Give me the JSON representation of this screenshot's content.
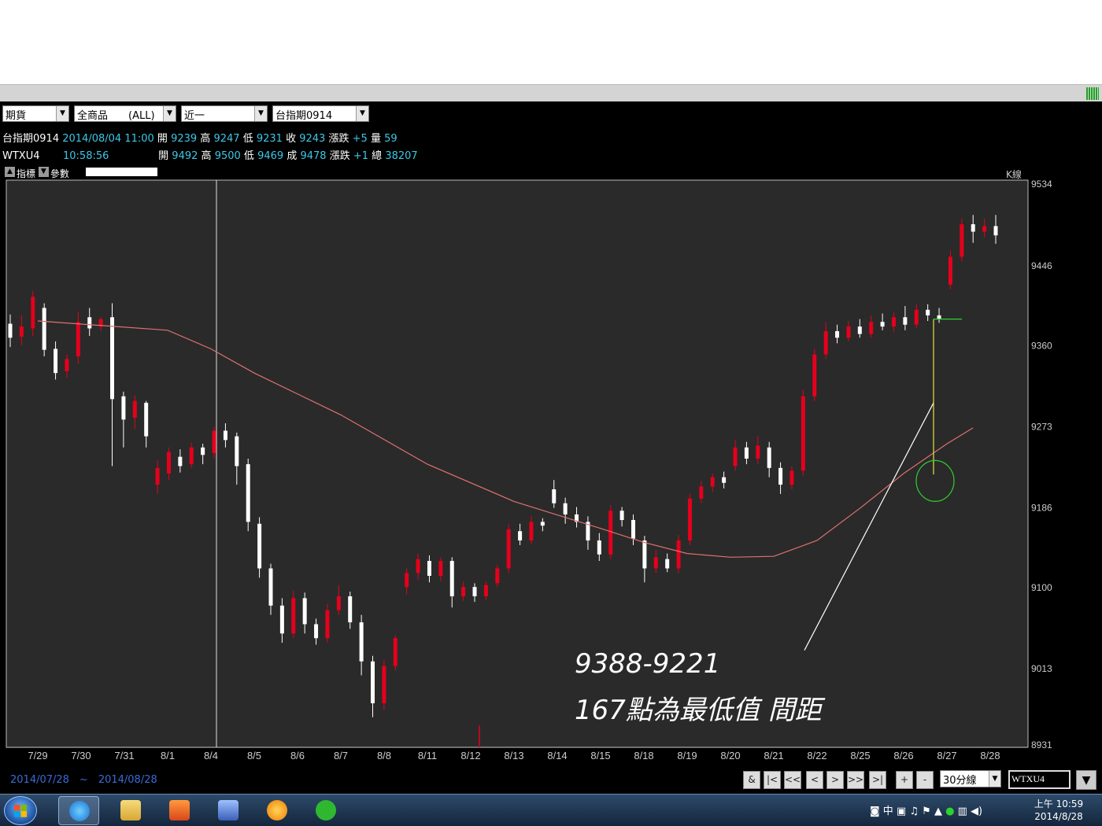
{
  "toolbar": {
    "market": "期貨",
    "product": "全商品　　(ALL)",
    "period": "近一",
    "contract": "台指期0914"
  },
  "quote1": {
    "name": "台指期0914",
    "datetime": "2014/08/04 11:00",
    "open_label": "開",
    "open": "9239",
    "high_label": "高",
    "high": "9247",
    "low_label": "低",
    "low": "9231",
    "close_label": "收",
    "close": "9243",
    "change_label": "漲跌",
    "change": "+5",
    "volume_label": "量",
    "volume": "59"
  },
  "quote2": {
    "name": "WTXU4",
    "time": "10:58:56",
    "open_label": "開",
    "open": "9492",
    "high_label": "高",
    "high": "9500",
    "low_label": "低",
    "low": "9469",
    "close_label": "成",
    "close": "9478",
    "change_label": "漲跌",
    "change": "+1",
    "volume_label": "總",
    "volume": "38207"
  },
  "indicator_bar": {
    "indicator_label": "指標",
    "param_label": "參數",
    "chart_type": "K線"
  },
  "chart_data": {
    "type": "candlestick",
    "y_ticks": [
      "9534",
      "9446",
      "9360",
      "9273",
      "9186",
      "9100",
      "9013",
      "8931"
    ],
    "ylim": [
      8931,
      9534
    ],
    "x_ticks": [
      "7/29",
      "7/30",
      "7/31",
      "8/1",
      "8/4",
      "8/5",
      "8/6",
      "8/7",
      "8/8",
      "8/11",
      "8/12",
      "8/13",
      "8/14",
      "8/15",
      "8/18",
      "8/19",
      "8/20",
      "8/21",
      "8/22",
      "8/25",
      "8/26",
      "8/27",
      "8/28"
    ],
    "interval": "30分線",
    "moving_average": [
      {
        "x": 0,
        "y": 9386
      },
      {
        "x": 3,
        "y": 9376
      },
      {
        "x": 4,
        "y": 9356
      },
      {
        "x": 5,
        "y": 9330
      },
      {
        "x": 7,
        "y": 9285
      },
      {
        "x": 9,
        "y": 9232
      },
      {
        "x": 11,
        "y": 9192
      },
      {
        "x": 13,
        "y": 9163
      },
      {
        "x": 14,
        "y": 9148
      },
      {
        "x": 15,
        "y": 9136
      },
      {
        "x": 16,
        "y": 9132
      },
      {
        "x": 17,
        "y": 9133
      },
      {
        "x": 18,
        "y": 9150
      },
      {
        "x": 19,
        "y": 9185
      },
      {
        "x": 20,
        "y": 9222
      },
      {
        "x": 21,
        "y": 9254
      },
      {
        "x": 21.6,
        "y": 9271
      }
    ],
    "candles": [
      [
        9383,
        9368,
        9393,
        9358
      ],
      [
        9369,
        9380,
        9392,
        9360
      ],
      [
        9378,
        9412,
        9418,
        9370
      ],
      [
        9400,
        9355,
        9405,
        9348
      ],
      [
        9356,
        9330,
        9364,
        9323
      ],
      [
        9332,
        9345,
        9350,
        9325
      ],
      [
        9348,
        9385,
        9396,
        9340
      ],
      [
        9390,
        9378,
        9400,
        9370
      ],
      [
        9380,
        9388,
        9390,
        9375
      ],
      [
        9390,
        9302,
        9405,
        9230
      ],
      [
        9305,
        9280,
        9310,
        9250
      ],
      [
        9282,
        9300,
        9306,
        9270
      ],
      [
        9298,
        9262,
        9300,
        9250
      ],
      [
        9210,
        9228,
        9236,
        9200
      ],
      [
        9222,
        9245,
        9250,
        9215
      ],
      [
        9240,
        9230,
        9248,
        9223
      ],
      [
        9232,
        9250,
        9255,
        9228
      ],
      [
        9250,
        9242,
        9254,
        9232
      ],
      [
        9244,
        9268,
        9272,
        9238
      ],
      [
        9268,
        9258,
        9276,
        9250
      ],
      [
        9262,
        9230,
        9266,
        9210
      ],
      [
        9232,
        9170,
        9238,
        9160
      ],
      [
        9168,
        9120,
        9175,
        9110
      ],
      [
        9120,
        9080,
        9125,
        9070
      ],
      [
        9080,
        9050,
        9088,
        9040
      ],
      [
        9050,
        9088,
        9096,
        9045
      ],
      [
        9088,
        9060,
        9094,
        9050
      ],
      [
        9060,
        9045,
        9066,
        9038
      ],
      [
        9045,
        9075,
        9082,
        9040
      ],
      [
        9075,
        9090,
        9102,
        9070
      ],
      [
        9090,
        9062,
        9095,
        9055
      ],
      [
        9062,
        9020,
        9070,
        9005
      ],
      [
        9020,
        8975,
        9026,
        8960
      ],
      [
        8975,
        9015,
        9022,
        8968
      ],
      [
        9015,
        9045,
        9048,
        9010
      ],
      [
        9100,
        9115,
        9120,
        9092
      ],
      [
        9115,
        9130,
        9136,
        9108
      ],
      [
        9128,
        9112,
        9134,
        9105
      ],
      [
        9112,
        9128,
        9132,
        9106
      ],
      [
        9128,
        9090,
        9132,
        9078
      ],
      [
        9090,
        9100,
        9106,
        9085
      ],
      [
        9100,
        9090,
        9104,
        9084
      ],
      [
        9090,
        9102,
        9106,
        9086
      ],
      [
        9104,
        9120,
        9124,
        9100
      ],
      [
        9120,
        9162,
        9168,
        9115
      ],
      [
        9160,
        9150,
        9168,
        9145
      ],
      [
        9150,
        9170,
        9176,
        9146
      ],
      [
        9170,
        9166,
        9174,
        9160
      ],
      [
        9205,
        9190,
        9215,
        9185
      ],
      [
        9190,
        9178,
        9196,
        9168
      ],
      [
        9178,
        9170,
        9186,
        9164
      ],
      [
        9170,
        9150,
        9176,
        9140
      ],
      [
        9150,
        9135,
        9158,
        9128
      ],
      [
        9135,
        9182,
        9188,
        9130
      ],
      [
        9182,
        9172,
        9186,
        9165
      ],
      [
        9172,
        9152,
        9178,
        9145
      ],
      [
        9150,
        9120,
        9155,
        9105
      ],
      [
        9120,
        9132,
        9140,
        9115
      ],
      [
        9130,
        9120,
        9136,
        9116
      ],
      [
        9120,
        9150,
        9156,
        9115
      ],
      [
        9150,
        9195,
        9200,
        9145
      ],
      [
        9195,
        9208,
        9214,
        9190
      ],
      [
        9208,
        9218,
        9222,
        9202
      ],
      [
        9218,
        9212,
        9224,
        9206
      ],
      [
        9230,
        9250,
        9258,
        9225
      ],
      [
        9250,
        9238,
        9256,
        9232
      ],
      [
        9238,
        9252,
        9262,
        9232
      ],
      [
        9250,
        9228,
        9256,
        9218
      ],
      [
        9228,
        9210,
        9234,
        9200
      ],
      [
        9210,
        9225,
        9230,
        9205
      ],
      [
        9225,
        9305,
        9312,
        9220
      ],
      [
        9305,
        9350,
        9356,
        9300
      ],
      [
        9350,
        9375,
        9385,
        9345
      ],
      [
        9375,
        9368,
        9382,
        9362
      ],
      [
        9368,
        9380,
        9386,
        9364
      ],
      [
        9380,
        9372,
        9388,
        9368
      ],
      [
        9372,
        9385,
        9392,
        9368
      ],
      [
        9385,
        9380,
        9394,
        9376
      ],
      [
        9380,
        9390,
        9396,
        9374
      ],
      [
        9390,
        9382,
        9402,
        9376
      ],
      [
        9382,
        9398,
        9404,
        9378
      ],
      [
        9398,
        9392,
        9404,
        9386
      ],
      [
        9392,
        9388,
        9400,
        9384
      ],
      [
        9425,
        9455,
        9462,
        9420
      ],
      [
        9455,
        9490,
        9496,
        9450
      ],
      [
        9490,
        9482,
        9500,
        9470
      ],
      [
        9482,
        9488,
        9496,
        9476
      ],
      [
        9488,
        9478,
        9500,
        9469
      ]
    ],
    "annotation_lines": [
      "9388-9221",
      "167點為最低值 間距"
    ]
  },
  "navigation": {
    "date_range": "2014/07/28　~　2014/08/28",
    "buttons": [
      "&",
      "|<",
      "<<",
      "<",
      ">",
      ">>",
      ">|",
      "+",
      "-"
    ],
    "interval": "30分線",
    "code": "WTXU4",
    "dropdown_glyph": "▼"
  },
  "taskbar": {
    "time": "上午 10:59",
    "date": "2014/8/28",
    "ime": "中"
  },
  "colors": {
    "up": "#e5001c",
    "down": "#ffffff",
    "ma": "#e07070",
    "plot_bg": "#2a2a2a",
    "accent_quote": "#3cc8e6"
  }
}
